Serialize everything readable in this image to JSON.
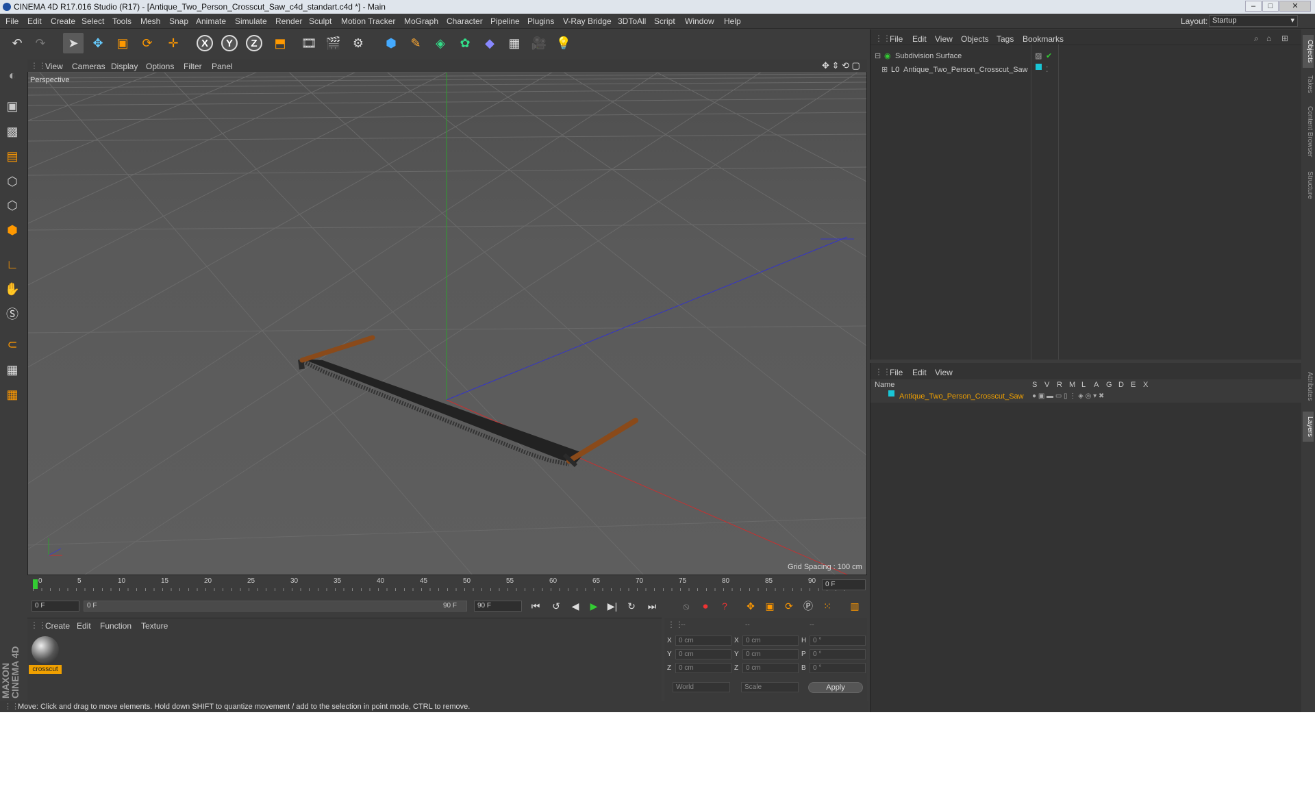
{
  "window": {
    "title": "CINEMA 4D R17.016 Studio (R17) - [Antique_Two_Person_Crosscut_Saw_c4d_standart.c4d *] - Main",
    "controls": {
      "minimize": "–",
      "maximize": "□",
      "close": "✕"
    }
  },
  "menubar": {
    "items": [
      "File",
      "Edit",
      "Create",
      "Select",
      "Tools",
      "Mesh",
      "Snap",
      "Animate",
      "Simulate",
      "Render",
      "Sculpt",
      "Motion Tracker",
      "MoGraph",
      "Character",
      "Pipeline",
      "Plugins",
      "V-Ray Bridge",
      "3DToAll",
      "Script",
      "Window",
      "Help"
    ],
    "layout_label": "Layout:",
    "layout_value": "Startup"
  },
  "toolbar": {
    "icons": [
      "undo-icon",
      "redo-icon",
      "select-arrow-icon",
      "move-icon",
      "scale-icon",
      "rotate-icon",
      "live-select-icon",
      "x-axis-icon",
      "y-axis-icon",
      "z-axis-icon",
      "coordinate-system-icon",
      "render-view-icon",
      "render-picture-viewer-icon",
      "render-settings-icon",
      "cube-icon",
      "pen-spline-icon",
      "subdivision-icon",
      "cloner-icon",
      "deformer-icon",
      "floor-icon",
      "camera-icon",
      "light-icon"
    ],
    "axis_labels": [
      "X",
      "Y",
      "Z"
    ]
  },
  "viewport": {
    "menu": [
      "View",
      "Cameras",
      "Display",
      "Options",
      "Filter",
      "Panel"
    ],
    "label": "Perspective",
    "grid_spacing": "Grid Spacing : 100 cm"
  },
  "timeline": {
    "ticks": [
      "0",
      "5",
      "10",
      "15",
      "20",
      "25",
      "30",
      "35",
      "40",
      "45",
      "50",
      "55",
      "60",
      "65",
      "70",
      "75",
      "80",
      "85",
      "90"
    ],
    "current_frame": "0 F"
  },
  "playback": {
    "start_field": "0 F",
    "range_start": "0 F",
    "range_end": "90 F",
    "end_field": "90 F"
  },
  "materials": {
    "menu": [
      "Create",
      "Edit",
      "Function",
      "Texture"
    ],
    "items": [
      {
        "name": "crosscut"
      }
    ]
  },
  "coordinates": {
    "header": [
      "--",
      "--",
      "--"
    ],
    "rows": [
      {
        "a": "X",
        "av": "0 cm",
        "b": "X",
        "bv": "0 cm",
        "c": "H",
        "cv": "0 °"
      },
      {
        "a": "Y",
        "av": "0 cm",
        "b": "Y",
        "bv": "0 cm",
        "c": "P",
        "cv": "0 °"
      },
      {
        "a": "Z",
        "av": "0 cm",
        "b": "Z",
        "bv": "0 cm",
        "c": "B",
        "cv": "0 °"
      }
    ],
    "world": "World",
    "scale": "Scale",
    "apply": "Apply"
  },
  "status": "Move: Click and drag to move elements. Hold down SHIFT to quantize movement / add to the selection in point mode, CTRL to remove.",
  "objects_panel": {
    "menu": [
      "File",
      "Edit",
      "View",
      "Objects",
      "Tags",
      "Bookmarks"
    ],
    "items": [
      {
        "name": "Subdivision Surface"
      },
      {
        "name": "Antique_Two_Person_Crosscut_Saw"
      }
    ]
  },
  "layers_panel": {
    "menu": [
      "File",
      "Edit",
      "View"
    ],
    "columns": [
      "Name",
      "S",
      "V",
      "R",
      "M",
      "L",
      "A",
      "G",
      "D",
      "E",
      "X"
    ],
    "items": [
      {
        "name": "Antique_Two_Person_Crosscut_Saw",
        "color": "#19c6d6"
      }
    ]
  },
  "right_tabs": [
    "Objects",
    "Takes",
    "Content Browser",
    "Structure",
    "Attributes",
    "Layers"
  ],
  "maxon": "MAXON CINEMA 4D",
  "colors": {
    "accent": "#f0a000",
    "layer": "#19c6d6",
    "x_axis": "#c83030",
    "y_axis": "#30a030",
    "z_axis": "#3a3ad0"
  }
}
